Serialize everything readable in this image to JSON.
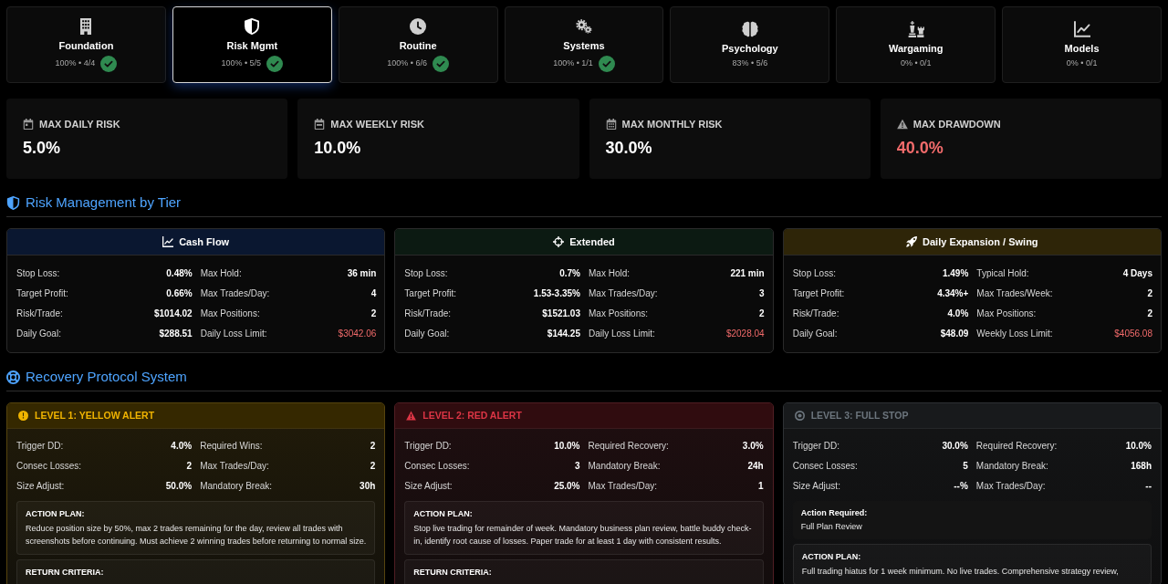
{
  "modules": [
    {
      "title": "Foundation",
      "progress": "100% • 4/4",
      "complete": true,
      "selected": false
    },
    {
      "title": "Risk Mgmt",
      "progress": "100% • 5/5",
      "complete": true,
      "selected": true
    },
    {
      "title": "Routine",
      "progress": "100% • 6/6",
      "complete": true,
      "selected": false
    },
    {
      "title": "Systems",
      "progress": "100% • 1/1",
      "complete": true,
      "selected": false
    },
    {
      "title": "Psychology",
      "progress": "83% • 5/6",
      "complete": false,
      "selected": false
    },
    {
      "title": "Wargaming",
      "progress": "0% • 0/1",
      "complete": false,
      "selected": false
    },
    {
      "title": "Models",
      "progress": "0% • 0/1",
      "complete": false,
      "selected": false
    }
  ],
  "risk_limits": [
    {
      "label": "MAX DAILY RISK",
      "value": "5.0%",
      "alert": false
    },
    {
      "label": "MAX WEEKLY RISK",
      "value": "10.0%",
      "alert": false
    },
    {
      "label": "MAX MONTHLY RISK",
      "value": "30.0%",
      "alert": false
    },
    {
      "label": "MAX DRAWDOWN",
      "value": "40.0%",
      "alert": true
    }
  ],
  "tier_section": {
    "title": "Risk Management by Tier"
  },
  "tiers": [
    {
      "title": "Cash Flow",
      "color": "#0a1730",
      "rows": [
        {
          "label": "Stop Loss:",
          "value": "0.48%",
          "alert": false
        },
        {
          "label": "Max Hold:",
          "value": "36 min",
          "alert": false
        },
        {
          "label": "Target Profit:",
          "value": "0.66%",
          "alert": false
        },
        {
          "label": "Max Trades/Day:",
          "value": "4",
          "alert": false
        },
        {
          "label": "Risk/Trade:",
          "value": "$1014.02",
          "alert": false
        },
        {
          "label": "Max Positions:",
          "value": "2",
          "alert": false
        },
        {
          "label": "Daily Goal:",
          "value": "$288.51",
          "alert": false
        },
        {
          "label": "Daily Loss Limit:",
          "value": "$3042.06",
          "alert": true
        }
      ]
    },
    {
      "title": "Extended",
      "color": "#0c1a12",
      "rows": [
        {
          "label": "Stop Loss:",
          "value": "0.7%",
          "alert": false
        },
        {
          "label": "Max Hold:",
          "value": "221 min",
          "alert": false
        },
        {
          "label": "Target Profit:",
          "value": "1.53-3.35%",
          "alert": false
        },
        {
          "label": "Max Trades/Day:",
          "value": "3",
          "alert": false
        },
        {
          "label": "Risk/Trade:",
          "value": "$1521.03",
          "alert": false
        },
        {
          "label": "Max Positions:",
          "value": "2",
          "alert": false
        },
        {
          "label": "Daily Goal:",
          "value": "$144.25",
          "alert": false
        },
        {
          "label": "Daily Loss Limit:",
          "value": "$2028.04",
          "alert": true
        }
      ]
    },
    {
      "title": "Daily Expansion / Swing",
      "color": "#2e2508",
      "rows": [
        {
          "label": "Stop Loss:",
          "value": "1.49%",
          "alert": false
        },
        {
          "label": "Typical Hold:",
          "value": "4 Days",
          "alert": false
        },
        {
          "label": "Target Profit:",
          "value": "4.34%+",
          "alert": false
        },
        {
          "label": "Max Trades/Week:",
          "value": "2",
          "alert": false
        },
        {
          "label": "Risk/Trade:",
          "value": "4.0%",
          "alert": false
        },
        {
          "label": "Max Positions:",
          "value": "2",
          "alert": false
        },
        {
          "label": "Daily Goal:",
          "value": "$48.09",
          "alert": false
        },
        {
          "label": "Weekly Loss Limit:",
          "value": "$4056.08",
          "alert": true
        }
      ]
    }
  ],
  "recovery_section": {
    "title": "Recovery Protocol System"
  },
  "levels": [
    {
      "title": "LEVEL 1: YELLOW ALERT",
      "color": "#f0b400",
      "stats": [
        {
          "label": "Trigger DD:",
          "value": "4.0%"
        },
        {
          "label": "Required Wins:",
          "value": "2"
        },
        {
          "label": "Consec Losses:",
          "value": "2"
        },
        {
          "label": "Max Trades/Day:",
          "value": "2"
        },
        {
          "label": "Size Adjust:",
          "value": "50.0%"
        },
        {
          "label": "Mandatory Break:",
          "value": "30h"
        }
      ],
      "action_plan": {
        "heading": "ACTION PLAN:",
        "text": "Reduce position size by 50%, max 2 trades remaining for the day, review all trades with screenshots before continuing. Must achieve 2 winning trades before returning to normal size."
      },
      "return_criteria": {
        "heading": "RETURN CRITERIA:"
      }
    },
    {
      "title": "LEVEL 2: RED ALERT",
      "color": "#dc3545",
      "stats": [
        {
          "label": "Trigger DD:",
          "value": "10.0%"
        },
        {
          "label": "Required Recovery:",
          "value": "3.0%"
        },
        {
          "label": "Consec Losses:",
          "value": "3"
        },
        {
          "label": "Mandatory Break:",
          "value": "24h"
        },
        {
          "label": "Size Adjust:",
          "value": "25.0%"
        },
        {
          "label": "Max Trades/Day:",
          "value": "1"
        }
      ],
      "action_plan": {
        "heading": "ACTION PLAN:",
        "text": "Stop live trading for remainder of week. Mandatory business plan review, battle buddy check-in, identify root cause of losses. Paper trade for at least 1 day with consistent results."
      },
      "return_criteria": {
        "heading": "RETURN CRITERIA:"
      }
    },
    {
      "title": "LEVEL 3: FULL STOP",
      "color": "#6c757d",
      "stats": [
        {
          "label": "Trigger DD:",
          "value": "30.0%"
        },
        {
          "label": "Required Recovery:",
          "value": "10.0%"
        },
        {
          "label": "Consec Losses:",
          "value": "5"
        },
        {
          "label": "Mandatory Break:",
          "value": "168h"
        },
        {
          "label": "Size Adjust:",
          "value": "--%"
        },
        {
          "label": "Max Trades/Day:",
          "value": "--"
        }
      ],
      "action_required": {
        "heading": "Action Required:",
        "text": "Full Plan Review"
      },
      "action_plan": {
        "heading": "ACTION PLAN:",
        "text": "Full trading hiatus for 1 week minimum. No live trades. Comprehensive strategy review,"
      }
    }
  ]
}
